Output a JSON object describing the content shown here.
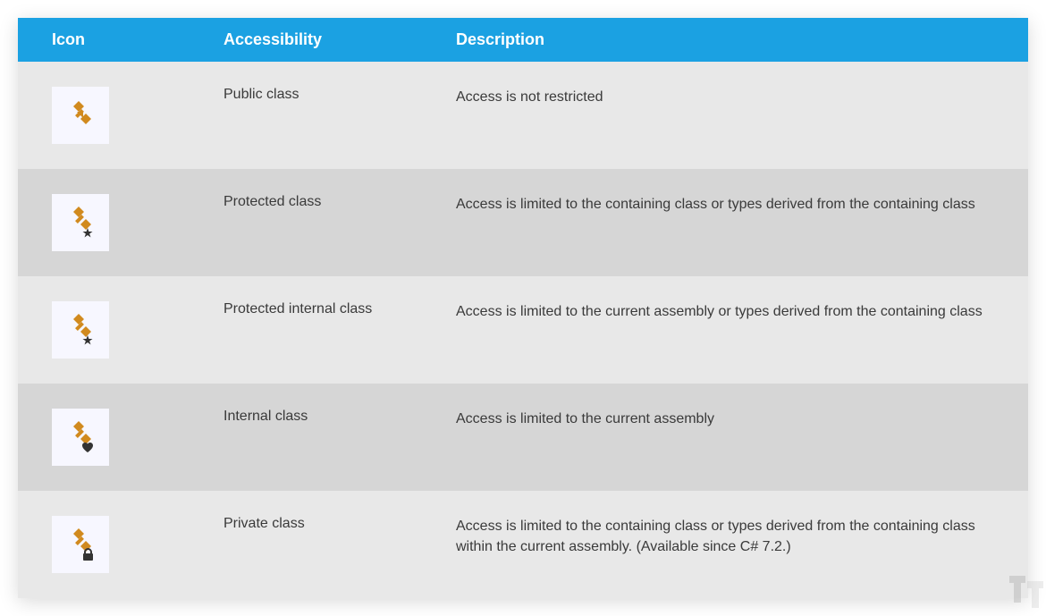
{
  "headers": {
    "icon": "Icon",
    "accessibility": "Accessibility",
    "description": "Description"
  },
  "rows": [
    {
      "icon": "class-public",
      "accessibility": "Public class",
      "description": "Access is not restricted"
    },
    {
      "icon": "class-protected",
      "accessibility": "Protected class",
      "description": "Access is limited to the containing class or types derived from the containing class"
    },
    {
      "icon": "class-protected-internal",
      "accessibility": "Protected internal class",
      "description": "Access is limited to the current assembly or types derived from the containing class"
    },
    {
      "icon": "class-internal",
      "accessibility": "Internal class",
      "description": "Access is limited to the current assembly"
    },
    {
      "icon": "class-private",
      "accessibility": "Private class",
      "description": "Access is limited to the containing class or types derived from the containing class within the current assembly. (Available since C# 7.2.)"
    }
  ],
  "colors": {
    "header_bg": "#1ba1e2",
    "icon_primary": "#d18a1e",
    "icon_overlay": "#333333"
  }
}
